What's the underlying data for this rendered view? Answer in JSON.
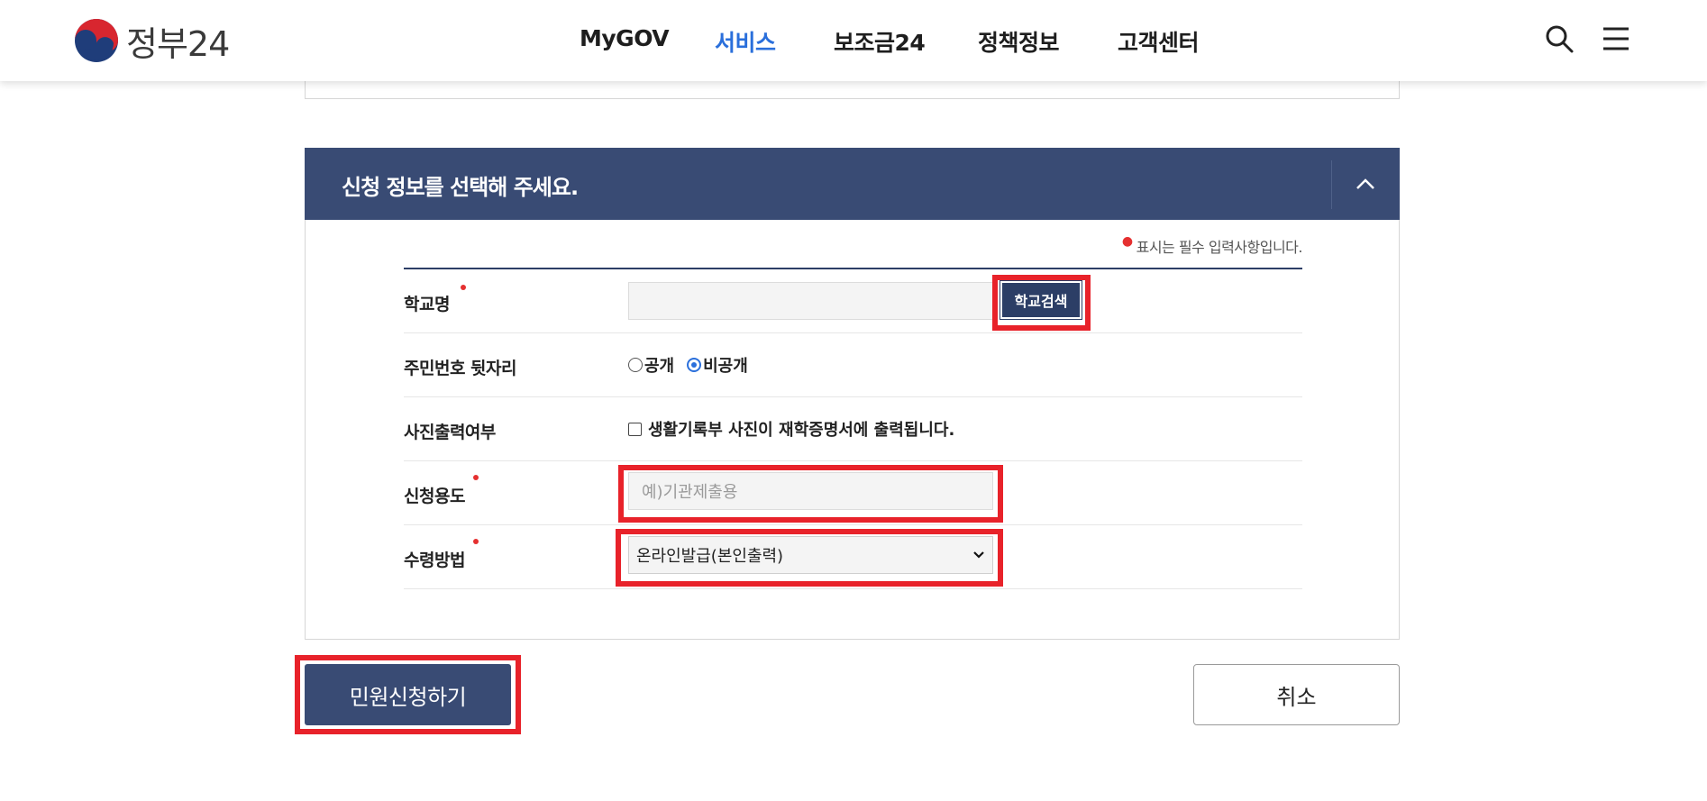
{
  "header": {
    "logo_text": "정부24",
    "nav": [
      "MyGOV",
      "서비스",
      "보조금24",
      "정책정보",
      "고객센터"
    ],
    "active_nav": "서비스"
  },
  "section": {
    "title": "신청 정보를 선택해 주세요.",
    "required_note": "표시는 필수 입력사항입니다."
  },
  "form": {
    "school": {
      "label": "학교명",
      "value": "",
      "search_button": "학교검색"
    },
    "rrn": {
      "label": "주민번호 뒷자리",
      "options": [
        "공개",
        "비공개"
      ],
      "selected": "비공개"
    },
    "photo": {
      "label": "사진출력여부",
      "checkbox_label": "생활기록부 사진이 재학증명서에 출력됩니다.",
      "checked": false
    },
    "purpose": {
      "label": "신청용도",
      "placeholder": "예)기관제출용"
    },
    "receive": {
      "label": "수령방법",
      "selected": "온라인발급(본인출력)"
    }
  },
  "buttons": {
    "apply": "민원신청하기",
    "cancel": "취소"
  },
  "colors": {
    "header_bg": "#394b74",
    "active_nav": "#2a6fdb",
    "highlight": "#e8222a",
    "required_dot": "#e53030"
  }
}
